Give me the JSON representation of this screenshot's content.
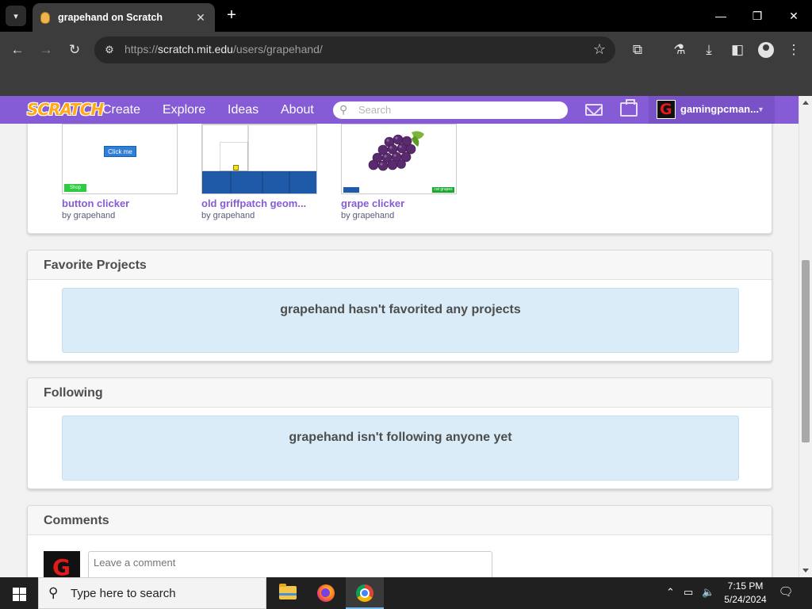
{
  "browser": {
    "tab_title": "grapehand on Scratch",
    "url_scheme": "https://",
    "url_host": "scratch.mit.edu",
    "url_path": "/users/grapehand/"
  },
  "nav": {
    "logo": "SCRATCH",
    "links": [
      "Create",
      "Explore",
      "Ideas",
      "About"
    ],
    "search_placeholder": "Search",
    "username": "gamingpcman..."
  },
  "projects": [
    {
      "title": "button clicker",
      "by": "by grapehand",
      "thumb_label": "Click me",
      "thumb_tag": "Shop"
    },
    {
      "title": "old griffpatch geom...",
      "by": "by grapehand"
    },
    {
      "title": "grape clicker",
      "by": "by grapehand",
      "thumb_tag": "cat grapes"
    }
  ],
  "favorites": {
    "header": "Favorite Projects",
    "empty_text": "grapehand hasn't favorited any projects"
  },
  "following": {
    "header": "Following",
    "empty_text": "grapehand isn't following anyone yet"
  },
  "comments": {
    "header": "Comments",
    "placeholder": "Leave a comment"
  },
  "taskbar": {
    "search_placeholder": "Type here to search",
    "time": "7:15 PM",
    "date": "5/24/2024"
  },
  "colors": {
    "scratch_purple": "#855cd6",
    "notice_blue": "#d9ecf8",
    "link_purple": "#855cd6"
  }
}
